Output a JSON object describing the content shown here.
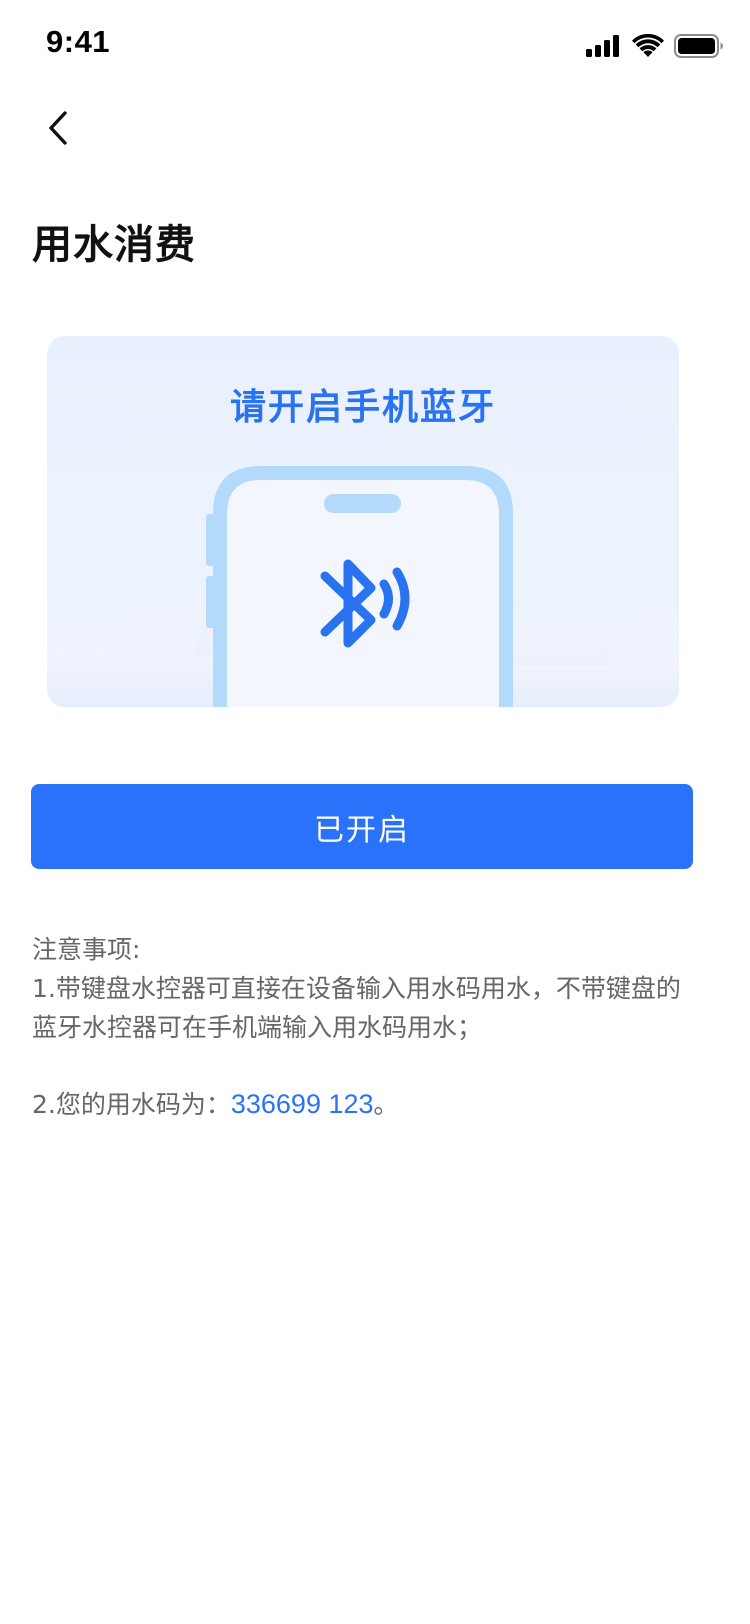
{
  "status_bar": {
    "time": "9:41",
    "icons": [
      "signal-icon",
      "wifi-icon",
      "battery-icon"
    ]
  },
  "nav": {
    "back_icon": "chevron-left-icon"
  },
  "page": {
    "title": "用水消费"
  },
  "bluetooth_card": {
    "title": "请开启手机蓝牙",
    "icon": "bluetooth-icon",
    "colors": {
      "accent": "#2a73f0",
      "phone_frame": "#b3d9fb",
      "phone_screen": "#f3f6fd",
      "background": "#e9f0fd"
    }
  },
  "primary_button": {
    "label": "已开启",
    "color": "#2b72fb"
  },
  "notes": {
    "heading": "注意事项:",
    "item1": "1.带键盘水控器可直接在设备输入用水码用水，不带键盘的蓝牙水控器可在手机端输入用水码用水；",
    "item2_prefix": "2.您的用水码为：",
    "item2_code": "336699 123",
    "item2_suffix": "。"
  }
}
